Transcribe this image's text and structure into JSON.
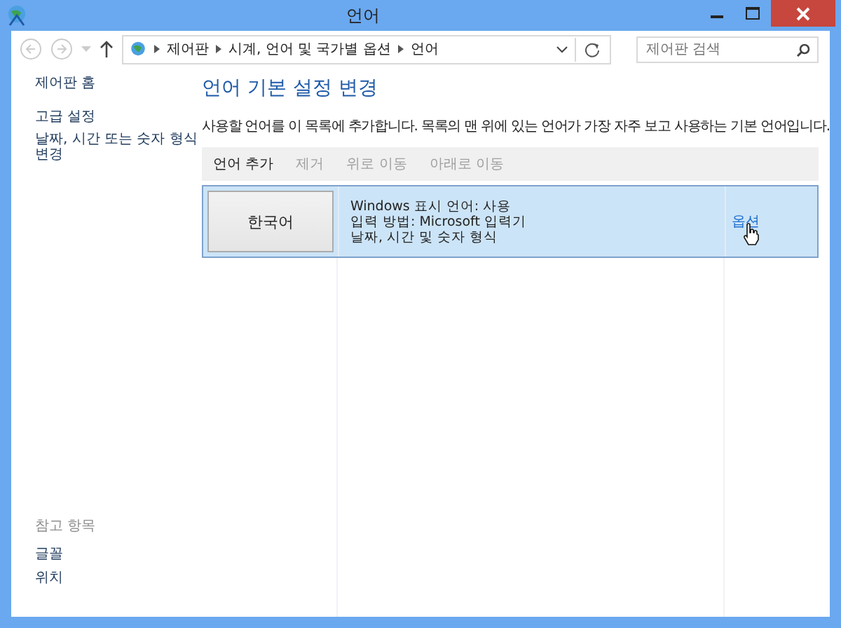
{
  "window": {
    "title": "언어"
  },
  "address_bar": {
    "crumbs": [
      "제어판",
      "시계, 언어 및 국가별 옵션",
      "언어"
    ]
  },
  "search": {
    "placeholder": "제어판 검색"
  },
  "sidebar": {
    "items": [
      {
        "label": "제어판 홈",
        "kind": "home"
      },
      {
        "label": "고급 설정",
        "kind": "link"
      },
      {
        "label": "날짜, 시간 또는 숫자 형식 변경",
        "kind": "link"
      }
    ],
    "see_also": {
      "title": "참고 항목",
      "items": [
        "글꼴",
        "위치"
      ]
    }
  },
  "main": {
    "heading": "언어 기본 설정 변경",
    "description": "사용할 언어를 이 목록에 추가합니다. 목록의 맨 위에 있는 언어가 가장 자주 보고 사용하는 기본 언어입니다.",
    "toolbar": [
      {
        "label": "언어 추가",
        "disabled": false
      },
      {
        "label": "제거",
        "disabled": true
      },
      {
        "label": "위로 이동",
        "disabled": true
      },
      {
        "label": "아래로 이동",
        "disabled": true
      }
    ],
    "languages": [
      {
        "name": "한국어",
        "details": [
          "Windows 표시 언어: 사용",
          "입력 방법: Microsoft 입력기",
          "날짜, 시간 및 숫자 형식"
        ],
        "options": "옵션",
        "selected": true
      }
    ]
  }
}
